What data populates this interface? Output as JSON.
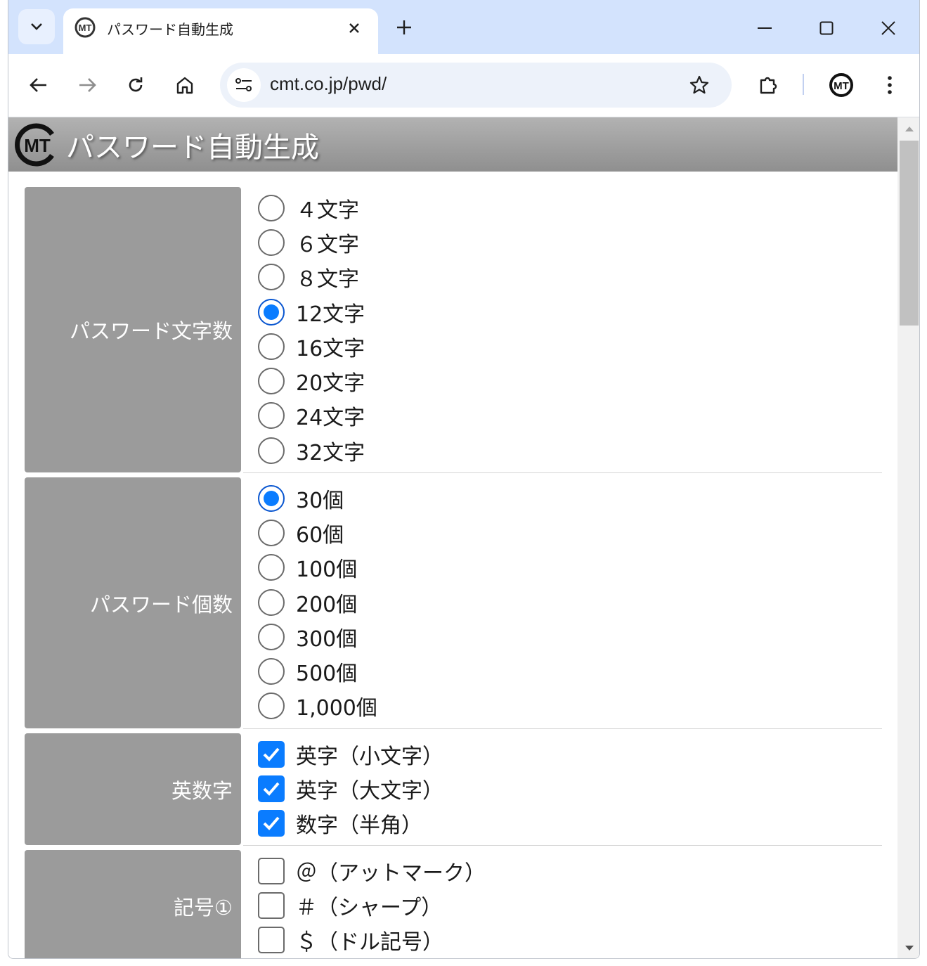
{
  "browser": {
    "tab_title": "パスワード自動生成",
    "url": "cmt.co.jp/pwd/",
    "favicon_text": "MT"
  },
  "page": {
    "header_title": "パスワード自動生成",
    "logo_text": "MT",
    "sections": [
      {
        "label": "パスワード文字数",
        "type": "radio",
        "options": [
          {
            "label": "４文字",
            "checked": false
          },
          {
            "label": "６文字",
            "checked": false
          },
          {
            "label": "８文字",
            "checked": false
          },
          {
            "label": "12文字",
            "checked": true
          },
          {
            "label": "16文字",
            "checked": false
          },
          {
            "label": "20文字",
            "checked": false
          },
          {
            "label": "24文字",
            "checked": false
          },
          {
            "label": "32文字",
            "checked": false
          }
        ]
      },
      {
        "label": "パスワード個数",
        "type": "radio",
        "options": [
          {
            "label": "30個",
            "checked": true
          },
          {
            "label": "60個",
            "checked": false
          },
          {
            "label": "100個",
            "checked": false
          },
          {
            "label": "200個",
            "checked": false
          },
          {
            "label": "300個",
            "checked": false
          },
          {
            "label": "500個",
            "checked": false
          },
          {
            "label": "1,000個",
            "checked": false
          }
        ]
      },
      {
        "label": "英数字",
        "type": "checkbox",
        "options": [
          {
            "label": "英字（小文字）",
            "checked": true
          },
          {
            "label": "英字（大文字）",
            "checked": true
          },
          {
            "label": "数字（半角）",
            "checked": true
          }
        ]
      },
      {
        "label": "記号①",
        "type": "checkbox",
        "options": [
          {
            "label": "＠（アットマーク）",
            "checked": false
          },
          {
            "label": "＃（シャープ）",
            "checked": false
          },
          {
            "label": "＄（ドル記号）",
            "checked": false
          }
        ]
      }
    ]
  },
  "colors": {
    "accent": "#0a7cff",
    "label_bg": "#9b9b9b",
    "tabstrip_bg": "#d3e3fd"
  }
}
